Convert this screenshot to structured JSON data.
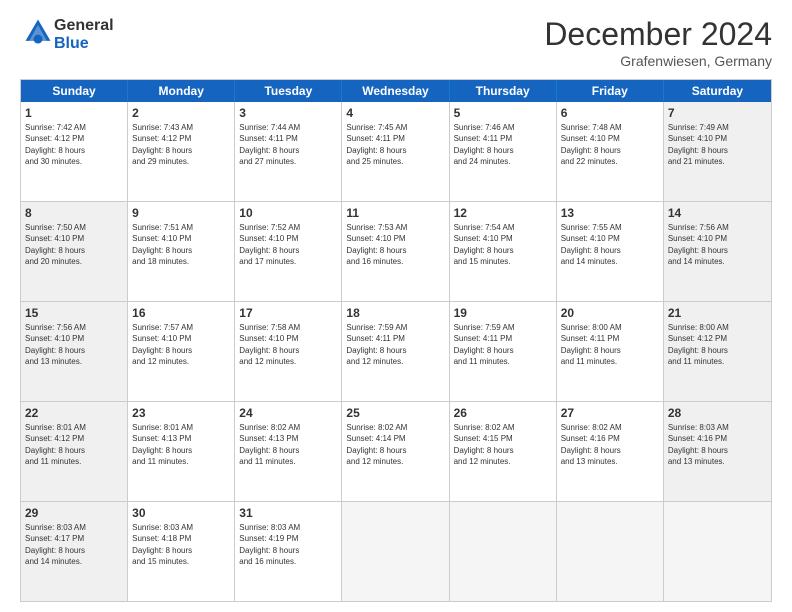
{
  "header": {
    "logo_general": "General",
    "logo_blue": "Blue",
    "month": "December 2024",
    "location": "Grafenwiesen, Germany"
  },
  "weekdays": [
    "Sunday",
    "Monday",
    "Tuesday",
    "Wednesday",
    "Thursday",
    "Friday",
    "Saturday"
  ],
  "rows": [
    [
      {
        "day": "1",
        "lines": [
          "Sunrise: 7:42 AM",
          "Sunset: 4:12 PM",
          "Daylight: 8 hours",
          "and 30 minutes."
        ],
        "shade": false
      },
      {
        "day": "2",
        "lines": [
          "Sunrise: 7:43 AM",
          "Sunset: 4:12 PM",
          "Daylight: 8 hours",
          "and 29 minutes."
        ],
        "shade": false
      },
      {
        "day": "3",
        "lines": [
          "Sunrise: 7:44 AM",
          "Sunset: 4:11 PM",
          "Daylight: 8 hours",
          "and 27 minutes."
        ],
        "shade": false
      },
      {
        "day": "4",
        "lines": [
          "Sunrise: 7:45 AM",
          "Sunset: 4:11 PM",
          "Daylight: 8 hours",
          "and 25 minutes."
        ],
        "shade": false
      },
      {
        "day": "5",
        "lines": [
          "Sunrise: 7:46 AM",
          "Sunset: 4:11 PM",
          "Daylight: 8 hours",
          "and 24 minutes."
        ],
        "shade": false
      },
      {
        "day": "6",
        "lines": [
          "Sunrise: 7:48 AM",
          "Sunset: 4:10 PM",
          "Daylight: 8 hours",
          "and 22 minutes."
        ],
        "shade": false
      },
      {
        "day": "7",
        "lines": [
          "Sunrise: 7:49 AM",
          "Sunset: 4:10 PM",
          "Daylight: 8 hours",
          "and 21 minutes."
        ],
        "shade": true
      }
    ],
    [
      {
        "day": "8",
        "lines": [
          "Sunrise: 7:50 AM",
          "Sunset: 4:10 PM",
          "Daylight: 8 hours",
          "and 20 minutes."
        ],
        "shade": true
      },
      {
        "day": "9",
        "lines": [
          "Sunrise: 7:51 AM",
          "Sunset: 4:10 PM",
          "Daylight: 8 hours",
          "and 18 minutes."
        ],
        "shade": false
      },
      {
        "day": "10",
        "lines": [
          "Sunrise: 7:52 AM",
          "Sunset: 4:10 PM",
          "Daylight: 8 hours",
          "and 17 minutes."
        ],
        "shade": false
      },
      {
        "day": "11",
        "lines": [
          "Sunrise: 7:53 AM",
          "Sunset: 4:10 PM",
          "Daylight: 8 hours",
          "and 16 minutes."
        ],
        "shade": false
      },
      {
        "day": "12",
        "lines": [
          "Sunrise: 7:54 AM",
          "Sunset: 4:10 PM",
          "Daylight: 8 hours",
          "and 15 minutes."
        ],
        "shade": false
      },
      {
        "day": "13",
        "lines": [
          "Sunrise: 7:55 AM",
          "Sunset: 4:10 PM",
          "Daylight: 8 hours",
          "and 14 minutes."
        ],
        "shade": false
      },
      {
        "day": "14",
        "lines": [
          "Sunrise: 7:56 AM",
          "Sunset: 4:10 PM",
          "Daylight: 8 hours",
          "and 14 minutes."
        ],
        "shade": true
      }
    ],
    [
      {
        "day": "15",
        "lines": [
          "Sunrise: 7:56 AM",
          "Sunset: 4:10 PM",
          "Daylight: 8 hours",
          "and 13 minutes."
        ],
        "shade": true
      },
      {
        "day": "16",
        "lines": [
          "Sunrise: 7:57 AM",
          "Sunset: 4:10 PM",
          "Daylight: 8 hours",
          "and 12 minutes."
        ],
        "shade": false
      },
      {
        "day": "17",
        "lines": [
          "Sunrise: 7:58 AM",
          "Sunset: 4:10 PM",
          "Daylight: 8 hours",
          "and 12 minutes."
        ],
        "shade": false
      },
      {
        "day": "18",
        "lines": [
          "Sunrise: 7:59 AM",
          "Sunset: 4:11 PM",
          "Daylight: 8 hours",
          "and 12 minutes."
        ],
        "shade": false
      },
      {
        "day": "19",
        "lines": [
          "Sunrise: 7:59 AM",
          "Sunset: 4:11 PM",
          "Daylight: 8 hours",
          "and 11 minutes."
        ],
        "shade": false
      },
      {
        "day": "20",
        "lines": [
          "Sunrise: 8:00 AM",
          "Sunset: 4:11 PM",
          "Daylight: 8 hours",
          "and 11 minutes."
        ],
        "shade": false
      },
      {
        "day": "21",
        "lines": [
          "Sunrise: 8:00 AM",
          "Sunset: 4:12 PM",
          "Daylight: 8 hours",
          "and 11 minutes."
        ],
        "shade": true
      }
    ],
    [
      {
        "day": "22",
        "lines": [
          "Sunrise: 8:01 AM",
          "Sunset: 4:12 PM",
          "Daylight: 8 hours",
          "and 11 minutes."
        ],
        "shade": true
      },
      {
        "day": "23",
        "lines": [
          "Sunrise: 8:01 AM",
          "Sunset: 4:13 PM",
          "Daylight: 8 hours",
          "and 11 minutes."
        ],
        "shade": false
      },
      {
        "day": "24",
        "lines": [
          "Sunrise: 8:02 AM",
          "Sunset: 4:13 PM",
          "Daylight: 8 hours",
          "and 11 minutes."
        ],
        "shade": false
      },
      {
        "day": "25",
        "lines": [
          "Sunrise: 8:02 AM",
          "Sunset: 4:14 PM",
          "Daylight: 8 hours",
          "and 12 minutes."
        ],
        "shade": false
      },
      {
        "day": "26",
        "lines": [
          "Sunrise: 8:02 AM",
          "Sunset: 4:15 PM",
          "Daylight: 8 hours",
          "and 12 minutes."
        ],
        "shade": false
      },
      {
        "day": "27",
        "lines": [
          "Sunrise: 8:02 AM",
          "Sunset: 4:16 PM",
          "Daylight: 8 hours",
          "and 13 minutes."
        ],
        "shade": false
      },
      {
        "day": "28",
        "lines": [
          "Sunrise: 8:03 AM",
          "Sunset: 4:16 PM",
          "Daylight: 8 hours",
          "and 13 minutes."
        ],
        "shade": true
      }
    ],
    [
      {
        "day": "29",
        "lines": [
          "Sunrise: 8:03 AM",
          "Sunset: 4:17 PM",
          "Daylight: 8 hours",
          "and 14 minutes."
        ],
        "shade": true
      },
      {
        "day": "30",
        "lines": [
          "Sunrise: 8:03 AM",
          "Sunset: 4:18 PM",
          "Daylight: 8 hours",
          "and 15 minutes."
        ],
        "shade": false
      },
      {
        "day": "31",
        "lines": [
          "Sunrise: 8:03 AM",
          "Sunset: 4:19 PM",
          "Daylight: 8 hours",
          "and 16 minutes."
        ],
        "shade": false
      },
      {
        "day": "",
        "lines": [],
        "empty": true,
        "shade": false
      },
      {
        "day": "",
        "lines": [],
        "empty": true,
        "shade": false
      },
      {
        "day": "",
        "lines": [],
        "empty": true,
        "shade": false
      },
      {
        "day": "",
        "lines": [],
        "empty": true,
        "shade": false
      }
    ]
  ]
}
